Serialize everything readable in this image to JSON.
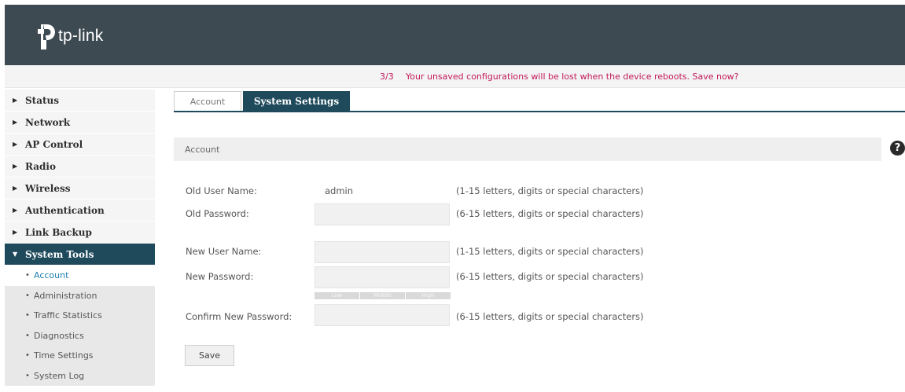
{
  "brand": {
    "logo_text": "tp-link"
  },
  "notice": {
    "count": "3/3",
    "message": "Your unsaved configurations will be lost when the device reboots. Save now?",
    "color": "#c2185b"
  },
  "colors": {
    "primary": "#1e4a5c",
    "header": "#3d4a51",
    "link_active": "#1f7fb0"
  },
  "sidebar": {
    "items": [
      {
        "label": "Status"
      },
      {
        "label": "Network"
      },
      {
        "label": "AP Control"
      },
      {
        "label": "Radio"
      },
      {
        "label": "Wireless"
      },
      {
        "label": "Authentication"
      },
      {
        "label": "Link Backup"
      },
      {
        "label": "System Tools"
      }
    ],
    "subitems": [
      {
        "label": "Account"
      },
      {
        "label": "Administration"
      },
      {
        "label": "Traffic Statistics"
      },
      {
        "label": "Diagnostics"
      },
      {
        "label": "Time Settings"
      },
      {
        "label": "System Log"
      }
    ]
  },
  "tabs": [
    {
      "label": "Account"
    },
    {
      "label": "System Settings"
    }
  ],
  "section": {
    "title": "Account",
    "help_icon": "question-icon"
  },
  "form": {
    "old_user_name": {
      "label": "Old User Name:",
      "value": "admin",
      "hint": "(1-15 letters, digits or special characters)"
    },
    "old_password": {
      "label": "Old Password:",
      "value": "",
      "hint": "(6-15 letters, digits or special characters)"
    },
    "new_user_name": {
      "label": "New User Name:",
      "value": "",
      "hint": "(1-15 letters, digits or special characters)"
    },
    "new_password": {
      "label": "New Password:",
      "value": "",
      "hint": "(6-15 letters, digits or special characters)"
    },
    "strength": [
      "Low",
      "Middle",
      "High"
    ],
    "confirm_password": {
      "label": "Confirm New Password:",
      "value": "",
      "hint": "(6-15 letters, digits or special characters)"
    },
    "save_label": "Save"
  }
}
